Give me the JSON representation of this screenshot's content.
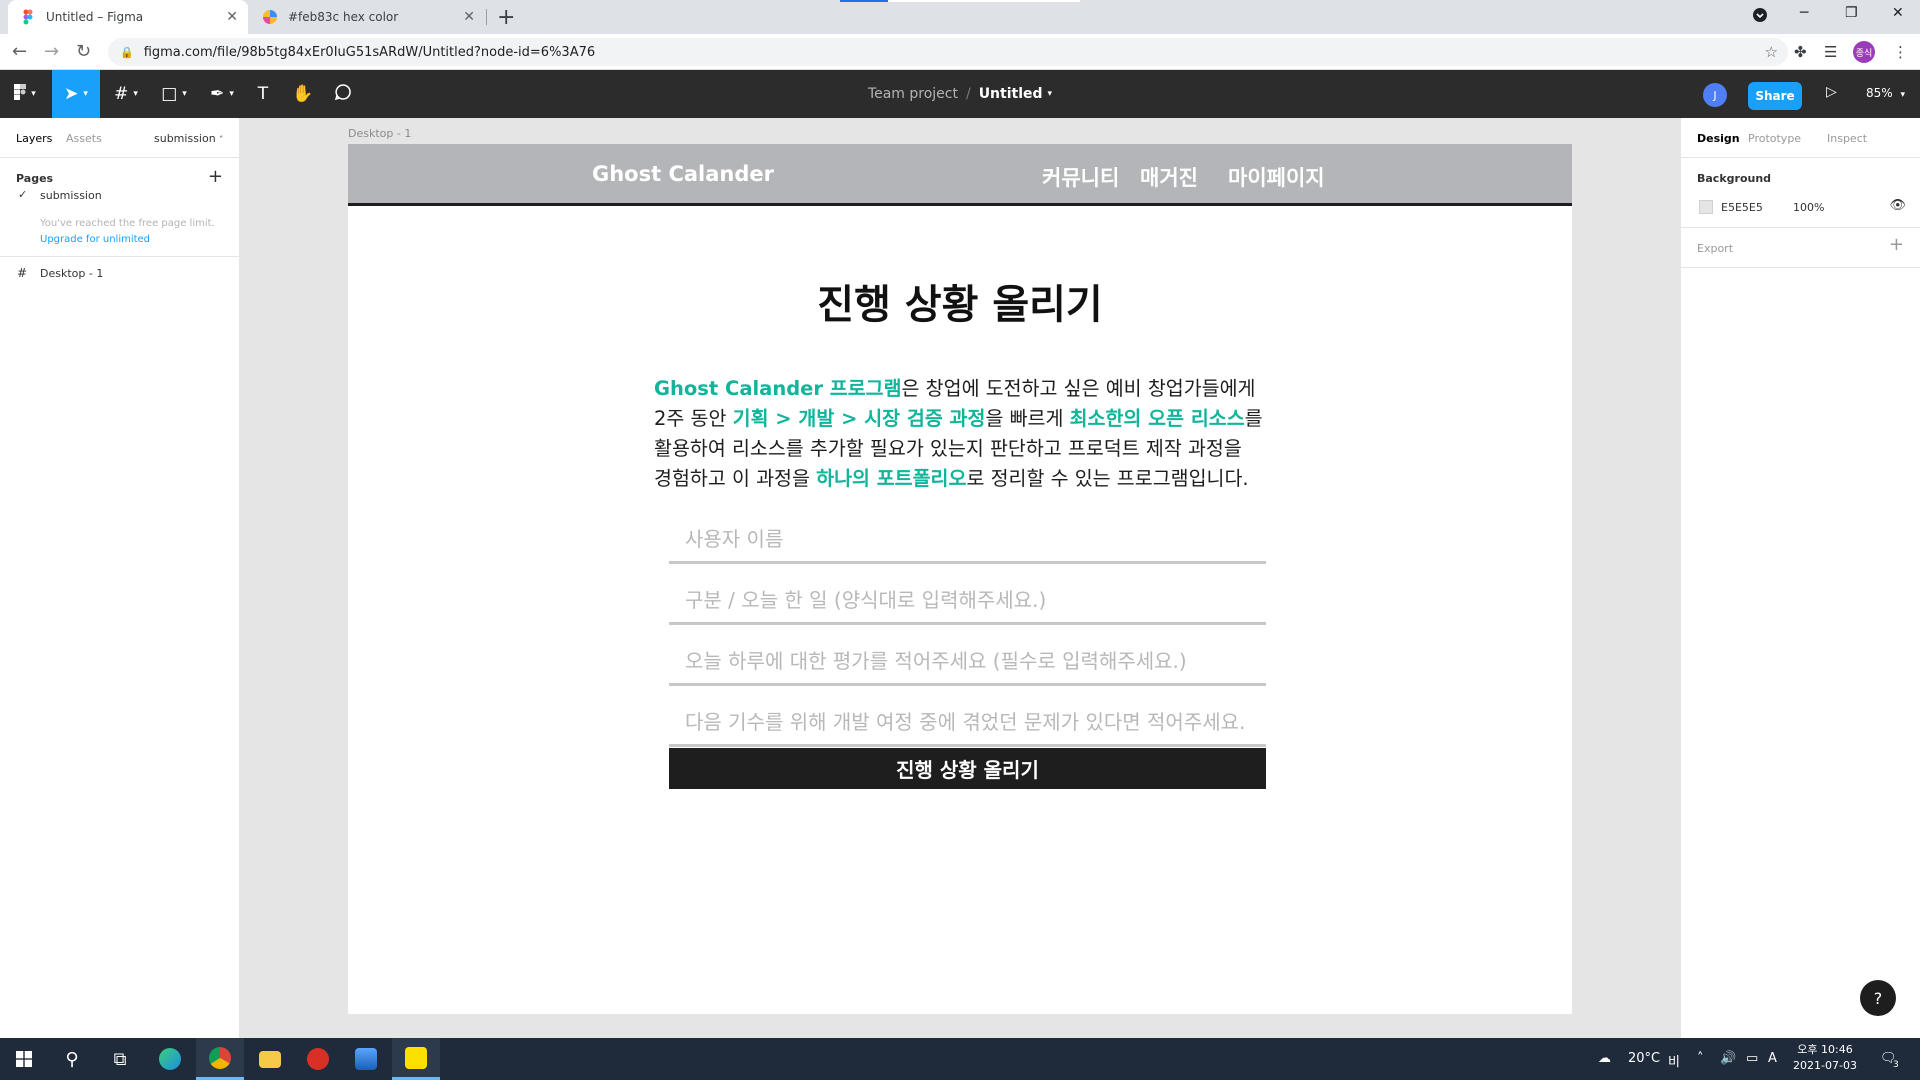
{
  "browser": {
    "tabs": [
      {
        "title": "Untitled – Figma",
        "active": true
      },
      {
        "title": "#feb83c hex color",
        "active": false
      }
    ],
    "url": "figma.com/file/98b5tg84xEr0IuG51sARdW/Untitled?node-id=6%3A76",
    "profile_initials": "종식"
  },
  "figma": {
    "breadcrumb_project": "Team project",
    "breadcrumb_separator": "/",
    "file_name": "Untitled",
    "user_initial": "J",
    "share_label": "Share",
    "zoom": "85%",
    "accent_color": "#18a0fb",
    "left_panel": {
      "tabs": [
        "Layers",
        "Assets"
      ],
      "current_page": "submission",
      "pages_label": "Pages",
      "pages": [
        {
          "name": "submission",
          "selected": true
        }
      ],
      "limit_note": "You've reached the free page limit.",
      "upgrade_link": "Upgrade for unlimited",
      "layers": [
        {
          "name": "Desktop - 1"
        }
      ]
    },
    "right_panel": {
      "tabs": [
        "Design",
        "Prototype",
        "Inspect"
      ],
      "background_label": "Background",
      "background_hex": "E5E5E5",
      "background_opacity": "100%",
      "export_label": "Export"
    },
    "help_label": "?"
  },
  "canvas": {
    "frame_label": "Desktop - 1",
    "background_color": "#e5e5e5",
    "site": {
      "logo": "Ghost Calander",
      "nav": [
        "커뮤니티",
        "매거진",
        "마이페이지"
      ],
      "title": "진행 상황 올리기",
      "intro": {
        "l1_a": "Ghost Calander 프로그램",
        "l1_b": "은 창업에 도전하고 싶은 예비 창업가들에게",
        "l2_a": "2주 동안 ",
        "l2_b": "기획 > 개발 > 시장 검증 과정",
        "l2_c": "을 빠르게 ",
        "l2_d": "최소한의 오픈 리소스",
        "l2_e": "를",
        "l3": "활용하여 리소스를 추가할 필요가 있는지 판단하고 프로덕트 제작 과정을",
        "l4_a": "경험하고 이 과정을 ",
        "l4_b": "하나의 포트폴리오",
        "l4_c": "로 정리할 수 있는 프로그램입니다."
      },
      "highlight_color": "#10b59a",
      "fields": [
        {
          "placeholder": "사용자 이름"
        },
        {
          "placeholder": "구분 / 오늘 한 일 (양식대로 입력해주세요.)"
        },
        {
          "placeholder": "오늘 하루에 대한 평가를 적어주세요 (필수로 입력해주세요.)"
        },
        {
          "placeholder": "다음 기수를 위해 개발 여정 중에 겪었던 문제가 있다면 적어주세요."
        }
      ],
      "submit_label": "진행 상황 올리기"
    }
  },
  "taskbar": {
    "weather": "20°C",
    "weather_desc": "비",
    "ime": "A",
    "time": "오후 10:46",
    "date": "2021-07-03",
    "notification_count": "3"
  }
}
